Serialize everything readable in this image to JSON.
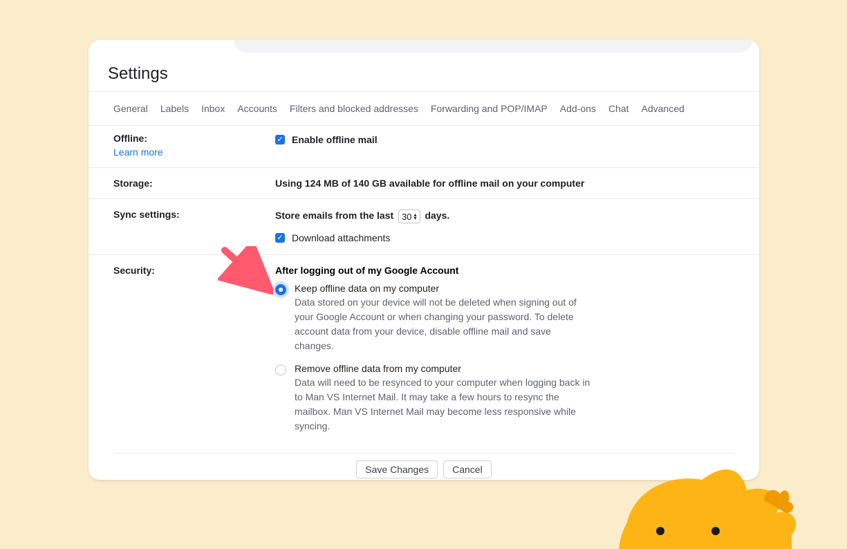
{
  "page_title": "Settings",
  "tabs": {
    "general": "General",
    "labels": "Labels",
    "inbox": "Inbox",
    "accounts": "Accounts",
    "filters": "Filters and blocked addresses",
    "forwarding": "Forwarding and POP/IMAP",
    "addons": "Add-ons",
    "chat": "Chat",
    "advanced": "Advanced"
  },
  "offline": {
    "label": "Offline:",
    "learn_more": "Learn more",
    "enable": "Enable offline mail"
  },
  "storage": {
    "label": "Storage:",
    "text": "Using 124 MB of 140 GB available for offline mail on your computer"
  },
  "sync": {
    "label": "Sync settings:",
    "pre": "Store emails from the last",
    "days_value": "30",
    "post": "days.",
    "download": "Download attachments"
  },
  "security": {
    "label": "Security:",
    "heading": "After logging out of my Google Account",
    "opt1_title": "Keep offline data on my computer",
    "opt1_desc": "Data stored on your device will not be deleted when signing out of your Google Account or when changing your password. To delete account data from your device, disable offline mail and save changes.",
    "opt2_title": "Remove offline data from my computer",
    "opt2_desc": "Data will need to be resynced to your computer when logging back in to Man VS Internet Mail. It may take a few hours to resync the mailbox. Man VS Internet Mail may become less responsive while syncing."
  },
  "actions": {
    "save": "Save Changes",
    "cancel": "Cancel"
  }
}
